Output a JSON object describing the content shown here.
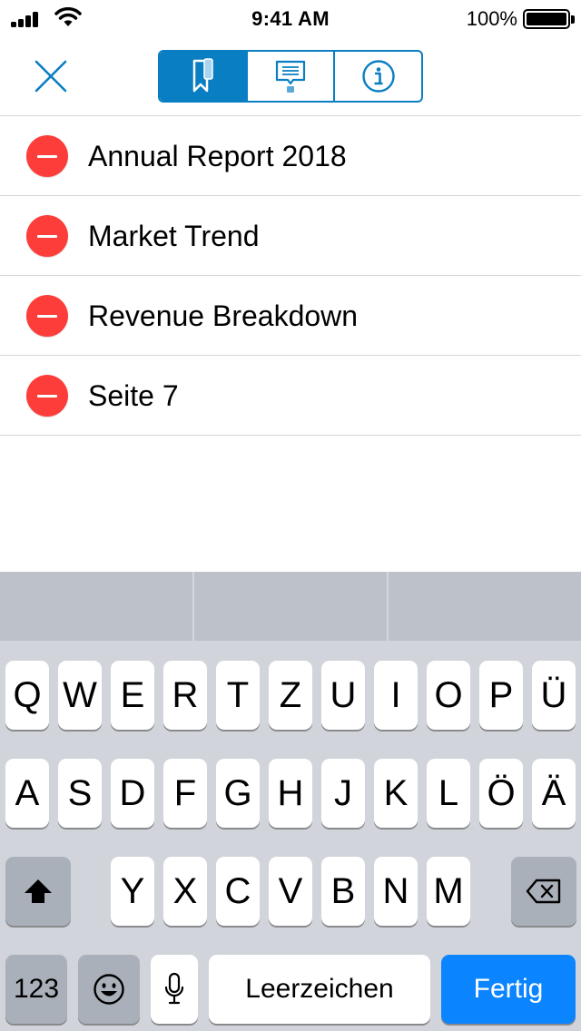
{
  "status_bar": {
    "time": "9:41 AM",
    "battery_percent": "100%",
    "battery_level": 1.0
  },
  "nav": {
    "close_icon": "close-icon",
    "segments": [
      {
        "icon": "bookmark-icon",
        "active": true
      },
      {
        "icon": "annotation-icon",
        "active": false
      },
      {
        "icon": "info-icon",
        "active": false
      }
    ],
    "accent_color": "#0a7ec2"
  },
  "bookmarks": [
    {
      "label": "Annual Report 2018"
    },
    {
      "label": "Market Trend"
    },
    {
      "label": "Revenue Breakdown"
    },
    {
      "label": "Seite 7"
    }
  ],
  "delete_color": "#fc3d39",
  "keyboard": {
    "row1": [
      "Q",
      "W",
      "E",
      "R",
      "T",
      "Z",
      "U",
      "I",
      "O",
      "P",
      "Ü"
    ],
    "row2": [
      "A",
      "S",
      "D",
      "F",
      "G",
      "H",
      "J",
      "K",
      "L",
      "Ö",
      "Ä"
    ],
    "row3": [
      "Y",
      "X",
      "C",
      "V",
      "B",
      "N",
      "M"
    ],
    "numbers_label": "123",
    "space_label": "Leerzeichen",
    "done_label": "Fertig",
    "done_color": "#0a84ff"
  }
}
